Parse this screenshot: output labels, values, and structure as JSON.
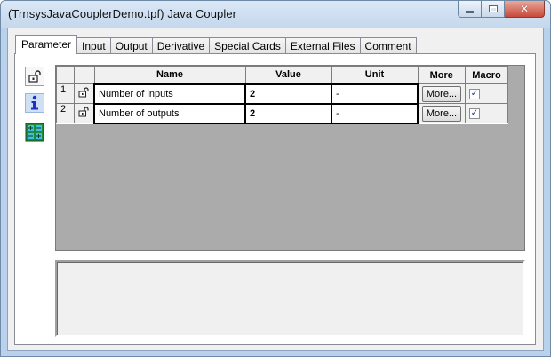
{
  "window": {
    "title": "(TrnsysJavaCouplerDemo.tpf) Java Coupler"
  },
  "tabs": [
    {
      "label": "Parameter",
      "active": true
    },
    {
      "label": "Input",
      "active": false
    },
    {
      "label": "Output",
      "active": false
    },
    {
      "label": "Derivative",
      "active": false
    },
    {
      "label": "Special Cards",
      "active": false
    },
    {
      "label": "External Files",
      "active": false
    },
    {
      "label": "Comment",
      "active": false
    }
  ],
  "side_toolbar": {
    "icons": [
      "lock-icon",
      "info-icon",
      "grid-icon"
    ]
  },
  "grid": {
    "headers": {
      "name": "Name",
      "value": "Value",
      "unit": "Unit",
      "more": "More",
      "macro": "Macro"
    },
    "rows": [
      {
        "index": "1",
        "name": "Number of inputs",
        "value": "2",
        "unit": "-",
        "more": "More...",
        "macro_checked": true
      },
      {
        "index": "2",
        "name": "Number of outputs",
        "value": "2",
        "unit": "-",
        "more": "More...",
        "macro_checked": true
      }
    ]
  },
  "colors": {
    "window_frame": "#b9d1ea",
    "close_button": "#c8493a",
    "grid_background": "#ababab"
  }
}
